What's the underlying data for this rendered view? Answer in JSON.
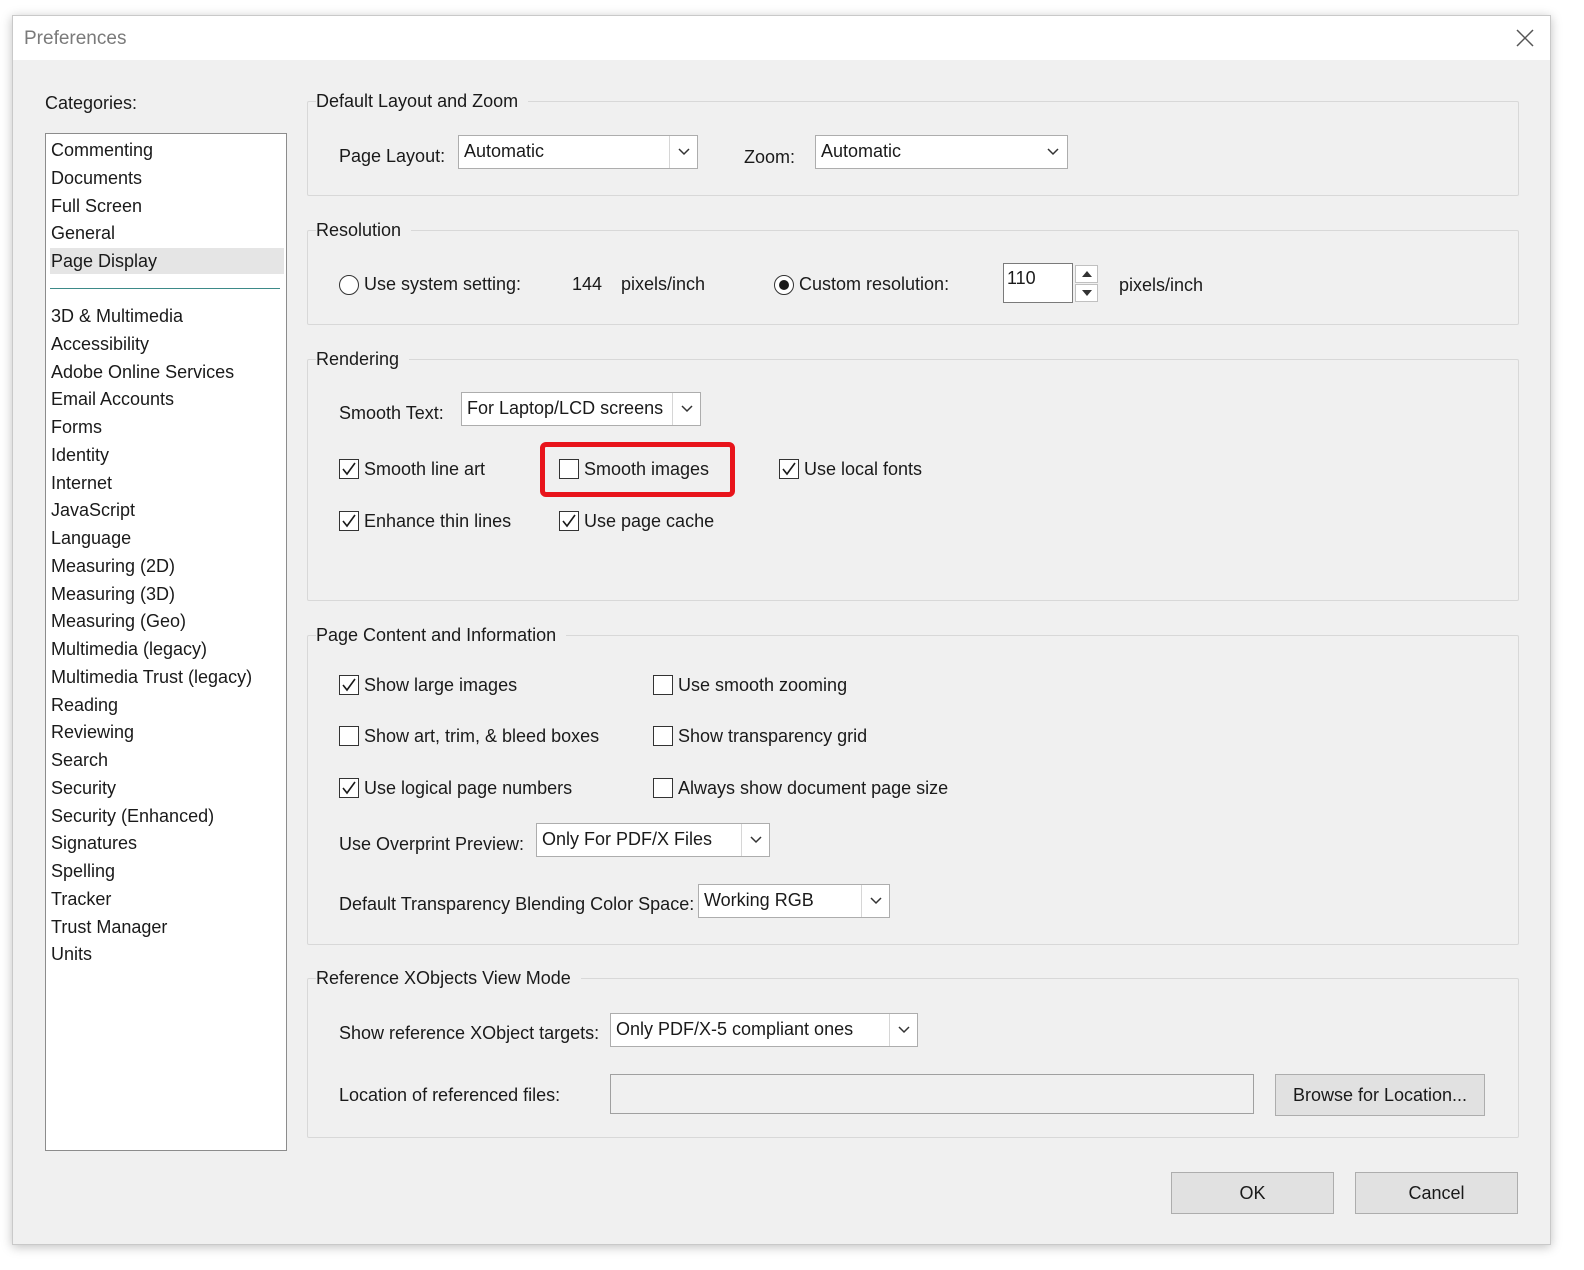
{
  "window": {
    "title": "Preferences"
  },
  "categories": {
    "heading": "Categories:",
    "items_top": [
      "Commenting",
      "Documents",
      "Full Screen",
      "General",
      "Page Display"
    ],
    "items_bottom": [
      "3D & Multimedia",
      "Accessibility",
      "Adobe Online Services",
      "Email Accounts",
      "Forms",
      "Identity",
      "Internet",
      "JavaScript",
      "Language",
      "Measuring (2D)",
      "Measuring (3D)",
      "Measuring (Geo)",
      "Multimedia (legacy)",
      "Multimedia Trust (legacy)",
      "Reading",
      "Reviewing",
      "Search",
      "Security",
      "Security (Enhanced)",
      "Signatures",
      "Spelling",
      "Tracker",
      "Trust Manager",
      "Units"
    ],
    "selected": "Page Display"
  },
  "layout_zoom": {
    "title": "Default Layout and Zoom",
    "page_layout_label": "Page Layout:",
    "page_layout_value": "Automatic",
    "zoom_label": "Zoom:",
    "zoom_value": "Automatic"
  },
  "resolution": {
    "title": "Resolution",
    "system_label": "Use system setting:",
    "system_value": "144",
    "system_unit": "pixels/inch",
    "system_selected": false,
    "custom_label": "Custom resolution:",
    "custom_value": "110",
    "custom_unit": "pixels/inch",
    "custom_selected": true
  },
  "rendering": {
    "title": "Rendering",
    "smooth_text_label": "Smooth Text:",
    "smooth_text_value": "For Laptop/LCD screens",
    "smooth_line_art": {
      "label": "Smooth line art",
      "checked": true
    },
    "smooth_images": {
      "label": "Smooth images",
      "checked": false
    },
    "use_local_fonts": {
      "label": "Use local fonts",
      "checked": true
    },
    "enhance_thin_lines": {
      "label": "Enhance thin lines",
      "checked": true
    },
    "use_page_cache": {
      "label": "Use page cache",
      "checked": true
    },
    "highlight_color": "#e8141b"
  },
  "page_content": {
    "title": "Page Content and Information",
    "show_large_images": {
      "label": "Show large images",
      "checked": true
    },
    "use_smooth_zooming": {
      "label": "Use smooth zooming",
      "checked": false
    },
    "show_art_trim_bleed": {
      "label": "Show art, trim, & bleed boxes",
      "checked": false
    },
    "show_transparency_grid": {
      "label": "Show transparency grid",
      "checked": false
    },
    "use_logical_page_numbers": {
      "label": "Use logical page numbers",
      "checked": true
    },
    "always_show_page_size": {
      "label": "Always show document page size",
      "checked": false
    },
    "overprint_label": "Use Overprint Preview:",
    "overprint_value": "Only For PDF/X Files",
    "blending_label": "Default Transparency Blending Color Space:",
    "blending_value": "Working RGB"
  },
  "xobjects": {
    "title": "Reference XObjects View Mode",
    "targets_label": "Show reference XObject targets:",
    "targets_value": "Only PDF/X-5 compliant ones",
    "location_label": "Location of referenced files:",
    "location_value": "",
    "browse_label": "Browse for Location..."
  },
  "buttons": {
    "ok": "OK",
    "cancel": "Cancel"
  }
}
